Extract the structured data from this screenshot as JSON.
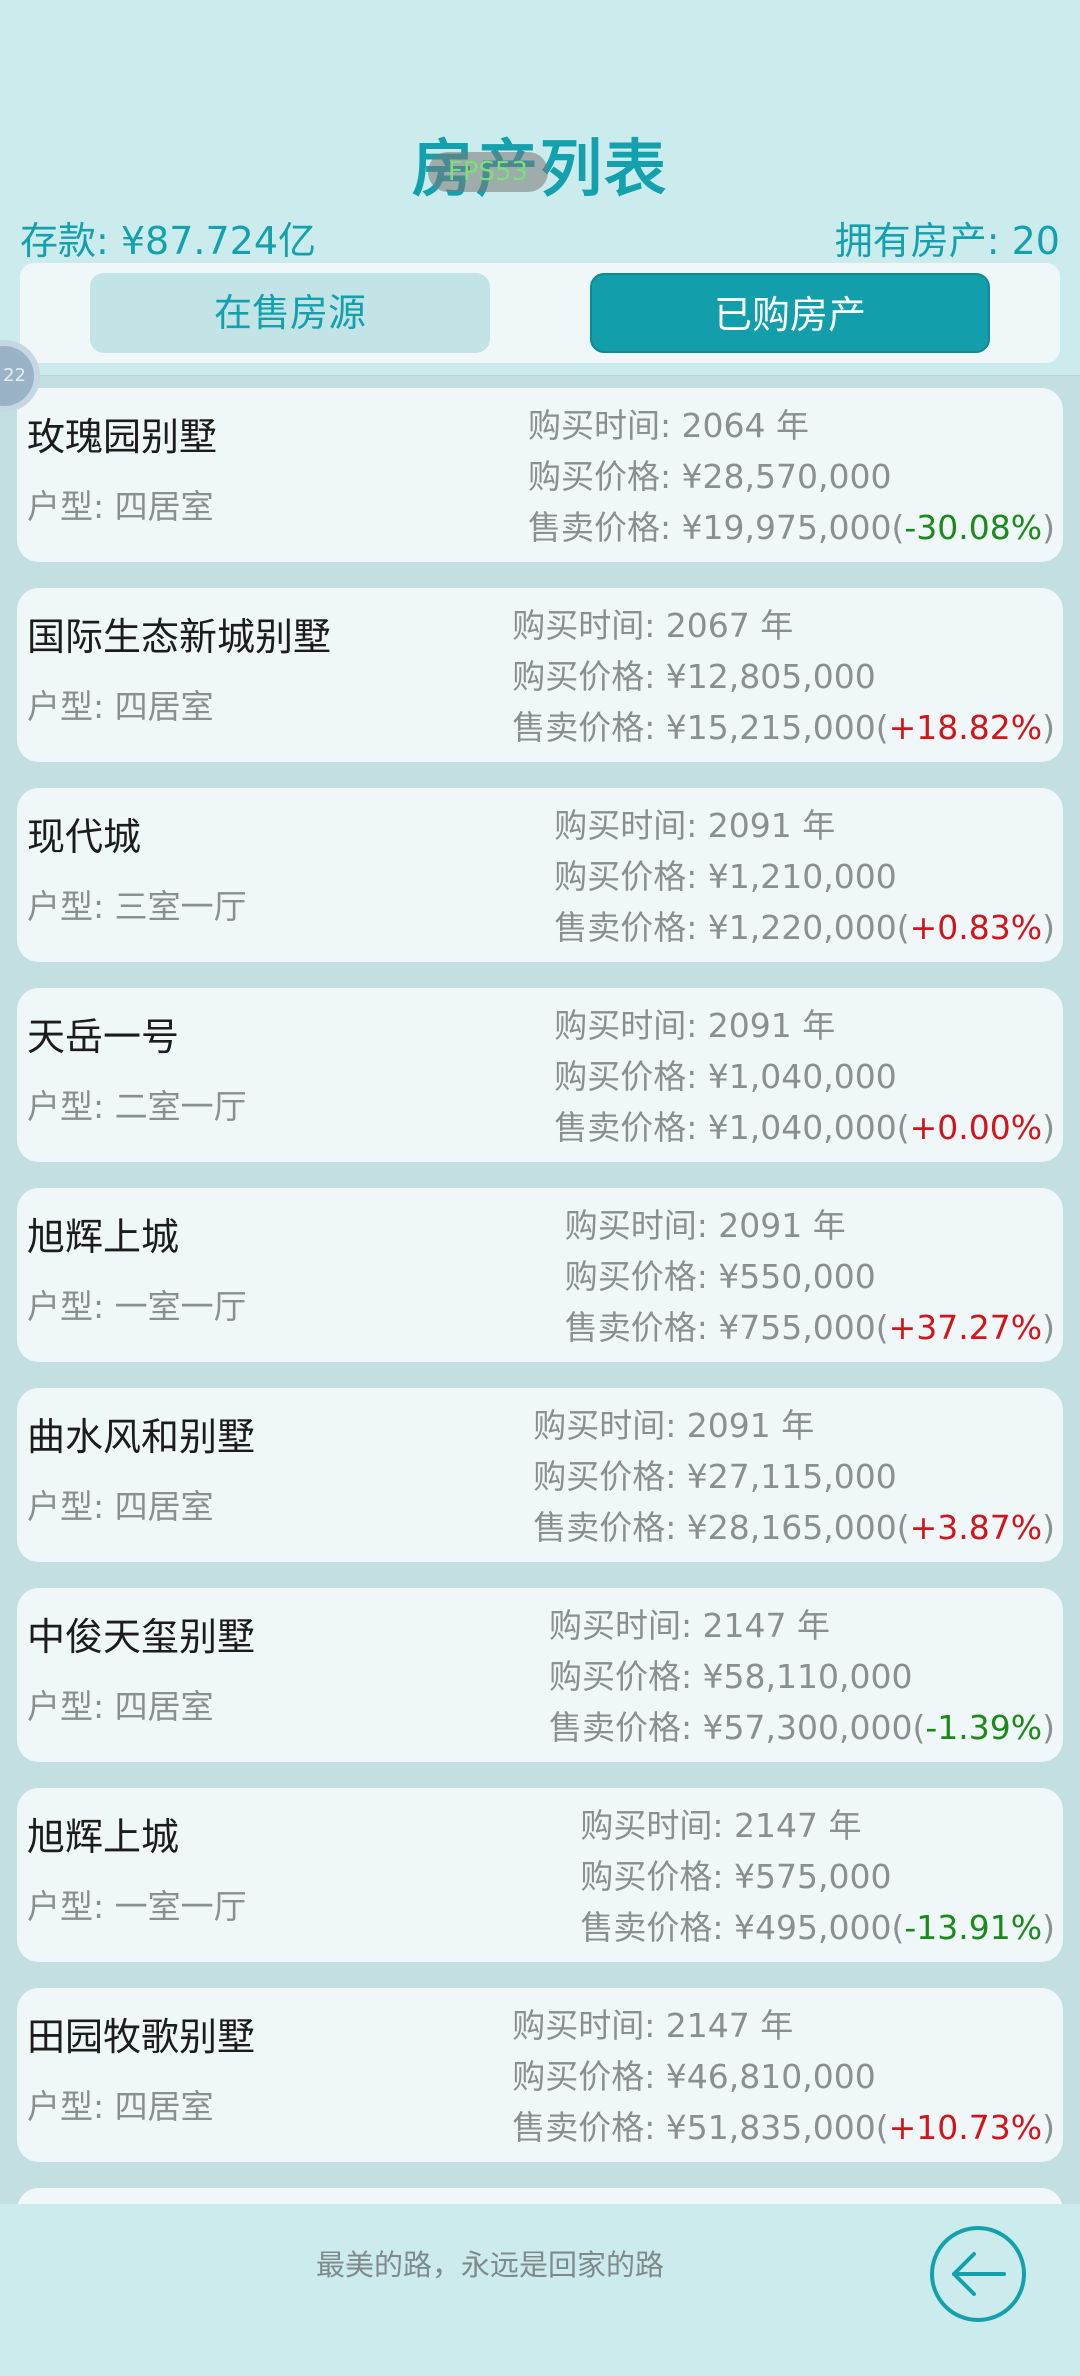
{
  "header": {
    "title": "房产列表",
    "fps": "FPS53",
    "savings": "存款: ¥87.724亿",
    "owned": "拥有房产: 20"
  },
  "tabs": [
    {
      "label": "在售房源",
      "active": false
    },
    {
      "label": "已购房产",
      "active": true
    }
  ],
  "float_ball": {
    "label": "22"
  },
  "properties": [
    {
      "name": "玫瑰园别墅",
      "type": "户型: 四居室",
      "buy_time": "购买时间: 2064 年",
      "buy_price": "购买价格: ¥28,570,000",
      "sell_price": "售卖价格: ¥19,975,000",
      "change": "-30.08%",
      "trend": "neg"
    },
    {
      "name": "国际生态新城别墅",
      "type": "户型: 四居室",
      "buy_time": "购买时间: 2067 年",
      "buy_price": "购买价格: ¥12,805,000",
      "sell_price": "售卖价格: ¥15,215,000",
      "change": "+18.82%",
      "trend": "pos"
    },
    {
      "name": "现代城",
      "type": "户型: 三室一厅",
      "buy_time": "购买时间: 2091 年",
      "buy_price": "购买价格: ¥1,210,000",
      "sell_price": "售卖价格: ¥1,220,000",
      "change": "+0.83%",
      "trend": "pos"
    },
    {
      "name": "天岳一号",
      "type": "户型: 二室一厅",
      "buy_time": "购买时间: 2091 年",
      "buy_price": "购买价格: ¥1,040,000",
      "sell_price": "售卖价格: ¥1,040,000",
      "change": "+0.00%",
      "trend": "pos"
    },
    {
      "name": "旭辉上城",
      "type": "户型: 一室一厅",
      "buy_time": "购买时间: 2091 年",
      "buy_price": "购买价格: ¥550,000",
      "sell_price": "售卖价格: ¥755,000",
      "change": "+37.27%",
      "trend": "pos"
    },
    {
      "name": "曲水风和别墅",
      "type": "户型: 四居室",
      "buy_time": "购买时间: 2091 年",
      "buy_price": "购买价格: ¥27,115,000",
      "sell_price": "售卖价格: ¥28,165,000",
      "change": "+3.87%",
      "trend": "pos"
    },
    {
      "name": "中俊天玺别墅",
      "type": "户型: 四居室",
      "buy_time": "购买时间: 2147 年",
      "buy_price": "购买价格: ¥58,110,000",
      "sell_price": "售卖价格: ¥57,300,000",
      "change": "-1.39%",
      "trend": "neg"
    },
    {
      "name": "旭辉上城",
      "type": "户型: 一室一厅",
      "buy_time": "购买时间: 2147 年",
      "buy_price": "购买价格: ¥575,000",
      "sell_price": "售卖价格: ¥495,000",
      "change": "-13.91%",
      "trend": "neg"
    },
    {
      "name": "田园牧歌别墅",
      "type": "户型: 四居室",
      "buy_time": "购买时间: 2147 年",
      "buy_price": "购买价格: ¥46,810,000",
      "sell_price": "售卖价格: ¥51,835,000",
      "change": "+10.73%",
      "trend": "pos"
    }
  ],
  "footer": {
    "slogan": "最美的路，永远是回家的路",
    "back_icon": "arrow-left-circle-icon"
  },
  "colors": {
    "accent": "#13a1ad",
    "negative": "#1a8a1a",
    "positive": "#d0151b"
  }
}
